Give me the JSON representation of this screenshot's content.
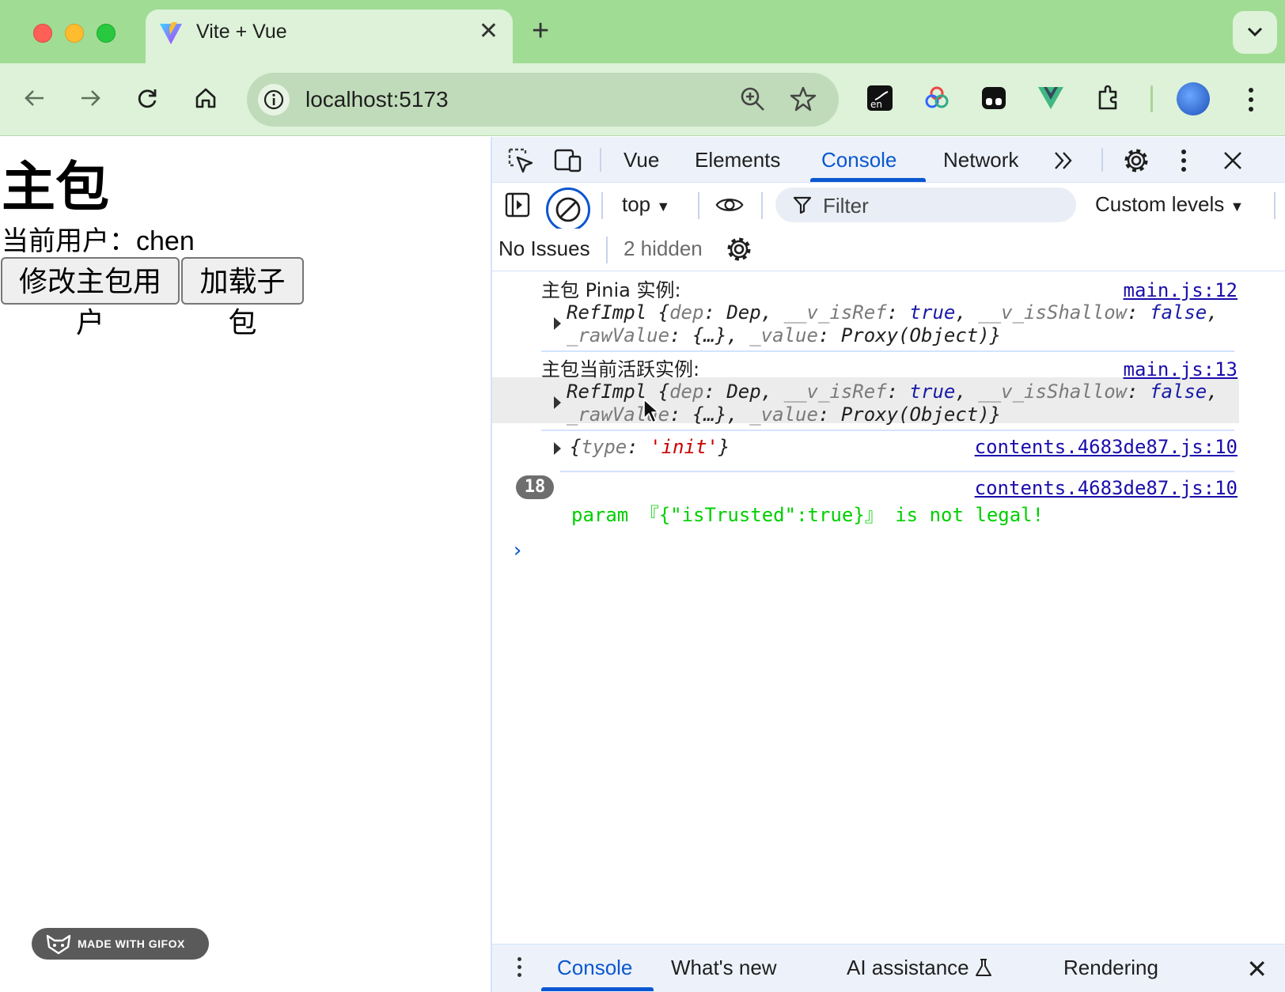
{
  "browser": {
    "tab_title": "Vite + Vue",
    "url": "localhost:5173",
    "icons": [
      "back-icon",
      "forward-icon",
      "reload-icon",
      "home-icon",
      "site-info-icon",
      "zoom-icon",
      "bookmark-star-icon",
      "extensions-icon"
    ]
  },
  "page": {
    "title": "主包",
    "user_label": "当前用户：",
    "user_name": "chen",
    "buttons": [
      "修改主包用户",
      "加载子包"
    ],
    "watermark": "MADE WITH GIFOX"
  },
  "devtools": {
    "tabs": [
      "Vue",
      "Elements",
      "Console",
      "Network"
    ],
    "active_tab": "Console",
    "context": "top",
    "filter_placeholder": "Filter",
    "levels": "Custom levels",
    "issues": "No Issues",
    "hidden": "2 hidden",
    "messages": [
      {
        "label": "主包 Pinia 实例:",
        "source": "main.js:12",
        "obj": {
          "class": "RefImpl",
          "dep_key": "dep",
          "dep_val": "Dep",
          "isref_key": "__v_isRef",
          "isref_val": "true",
          "isshallow_key": "__v_isShallow",
          "isshallow_val": "false",
          "raw_key": "_rawValue",
          "raw_val": "{…}",
          "value_key": "_value",
          "value_val": "Proxy(Object)"
        }
      },
      {
        "label": "主包当前活跃实例:",
        "source": "main.js:13",
        "obj": {
          "class": "RefImpl",
          "dep_key": "dep",
          "dep_val": "Dep",
          "isref_key": "__v_isRef",
          "isref_val": "true",
          "isshallow_key": "__v_isShallow",
          "isshallow_val": "false",
          "raw_key": "_rawValue",
          "raw_val": "{…}",
          "value_key": "_value",
          "value_val": "Proxy(Object)"
        }
      },
      {
        "source": "contents.4683de87.js:10",
        "obj": {
          "type_key": "type",
          "type_val": "'init'"
        }
      },
      {
        "count": "18",
        "source": "contents.4683de87.js:10",
        "text": "param 『{\"isTrusted\":true}』 is not legal!"
      }
    ],
    "drawer_tabs": [
      "Console",
      "What's new",
      "AI assistance",
      "Rendering"
    ]
  },
  "colors": {
    "tab_strip": "#a0dc94",
    "toolbar": "#ddf2d8",
    "accent": "#0b57d0",
    "log_green": "#00cf00",
    "link": "#1a0dab"
  }
}
